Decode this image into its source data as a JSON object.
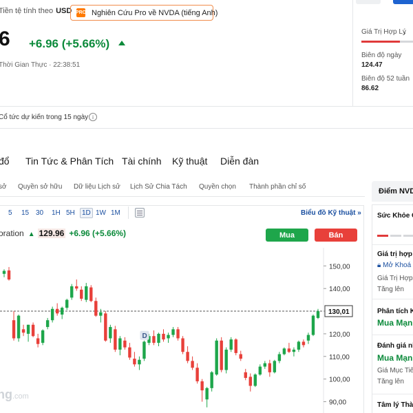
{
  "header": {
    "currency_label": "Tiền tệ tính theo",
    "currency": "USD",
    "pro_button": "Nghiên Cứu Pro về NVDA (tiếng Anh)",
    "pro_icon": "pro-badge-icon",
    "price_partial": "6",
    "change": "+6.96 (+5.66%)",
    "realtime": "Thời Gian Thực · 22:38:51",
    "dividend": "Cổ tức dự kiến trong 15 ngày"
  },
  "right_panel": {
    "fair_value_label": "Giá Trị Hợp Lý",
    "fair_value_fill": 0.7,
    "day_range_label": "Biên độ ngày",
    "day_range_value": "124.47",
    "week52_label": "Biên độ 52 tuần",
    "week52_value": "86.62"
  },
  "nav": {
    "tabs": [
      "đổ",
      "Tin Tức & Phân Tích",
      "Tài chính",
      "Kỹ thuật",
      "Diễn đàn"
    ],
    "subtabs": [
      "sở",
      "Quyền sở hữu",
      "Dữ liệu Lịch sử",
      "Lịch Sử Chia Tách",
      "Quyền chọn",
      "Thành phần chỉ số"
    ]
  },
  "toolbar": {
    "timeframes": [
      "5",
      "15",
      "30",
      "1H",
      "5H",
      "1D",
      "1W",
      "1M"
    ],
    "selected": "1D",
    "tech_chart_link": "Biểu đồ Kỹ thuật",
    "tech_chart_chevron": "»"
  },
  "ticker": {
    "name": "oration",
    "price": "129.96",
    "change": "+6.96 (+5.66%)",
    "buy": "Mua",
    "sell": "Bán"
  },
  "side": {
    "title": "Điểm NVD",
    "health": "Sức Khỏe C",
    "health_fill": 0.33,
    "fair_value": "Giá trị hợp l",
    "fair_value_link": "Mở Khoá",
    "fair_value_sub": "Giá Trị Hợp",
    "fair_value_trend": "Tăng lên",
    "analyst": "Phân tích K",
    "analyst_rating": "Mua Mạnh",
    "rating_label": "Đánh giá nh",
    "rating_value": "Mua Mạnh",
    "target_label": "Giá Mục Tiê",
    "target_trend": "Tăng lên",
    "sentiment": "Tâm lý Thà"
  },
  "watermark": {
    "main": "ng",
    "suffix": ".com"
  },
  "chart_data": {
    "type": "candlestick",
    "y_ticks": [
      "150,00",
      "140,00",
      "130,00",
      "120,00",
      "110,00",
      "100,00",
      "90,00"
    ],
    "ylim": [
      85,
      158
    ],
    "current_price_label": "130,01",
    "current_price": 130.01,
    "dividend_marker": "D",
    "up_color": "#1ea64b",
    "down_color": "#e8403a",
    "candles": [
      {
        "o": 146.5,
        "h": 148.5,
        "l": 145.0,
        "c": 147.8
      },
      {
        "o": 148.0,
        "h": 149.5,
        "l": 143.5,
        "c": 144.0
      },
      {
        "o": 126.0,
        "h": 130.0,
        "l": 117.0,
        "c": 118.0
      },
      {
        "o": 118.0,
        "h": 128.5,
        "l": 116.5,
        "c": 128.0
      },
      {
        "o": 122.0,
        "h": 124.0,
        "l": 119.0,
        "c": 120.5
      },
      {
        "o": 120.0,
        "h": 124.0,
        "l": 116.5,
        "c": 124.0
      },
      {
        "o": 124.0,
        "h": 125.0,
        "l": 118.5,
        "c": 119.0
      },
      {
        "o": 118.0,
        "h": 120.0,
        "l": 114.0,
        "c": 115.5
      },
      {
        "o": 116.0,
        "h": 122.0,
        "l": 115.0,
        "c": 121.5
      },
      {
        "o": 123.0,
        "h": 127.0,
        "l": 122.0,
        "c": 126.0
      },
      {
        "o": 126.0,
        "h": 132.0,
        "l": 125.0,
        "c": 131.0
      },
      {
        "o": 131.0,
        "h": 133.5,
        "l": 128.0,
        "c": 129.0
      },
      {
        "o": 128.5,
        "h": 132.0,
        "l": 126.5,
        "c": 131.5
      },
      {
        "o": 131.5,
        "h": 135.5,
        "l": 130.5,
        "c": 135.0
      },
      {
        "o": 136.0,
        "h": 142.0,
        "l": 135.0,
        "c": 141.0
      },
      {
        "o": 141.0,
        "h": 144.0,
        "l": 139.0,
        "c": 140.0
      },
      {
        "o": 139.5,
        "h": 141.0,
        "l": 134.5,
        "c": 135.5
      },
      {
        "o": 135.0,
        "h": 142.5,
        "l": 134.0,
        "c": 141.0
      },
      {
        "o": 140.5,
        "h": 141.5,
        "l": 134.0,
        "c": 134.5
      },
      {
        "o": 134.5,
        "h": 136.0,
        "l": 127.5,
        "c": 128.0
      },
      {
        "o": 128.0,
        "h": 131.0,
        "l": 125.0,
        "c": 129.5
      },
      {
        "o": 129.0,
        "h": 130.0,
        "l": 116.5,
        "c": 117.0
      },
      {
        "o": 118.0,
        "h": 124.0,
        "l": 116.0,
        "c": 123.0
      },
      {
        "o": 122.0,
        "h": 123.5,
        "l": 112.0,
        "c": 113.0
      },
      {
        "o": 113.0,
        "h": 119.0,
        "l": 110.5,
        "c": 118.0
      },
      {
        "o": 117.0,
        "h": 118.5,
        "l": 113.0,
        "c": 114.0
      },
      {
        "o": 114.0,
        "h": 116.0,
        "l": 108.5,
        "c": 109.5
      },
      {
        "o": 109.0,
        "h": 112.0,
        "l": 105.5,
        "c": 106.5
      },
      {
        "o": 106.5,
        "h": 110.0,
        "l": 104.0,
        "c": 108.5
      },
      {
        "o": 109.0,
        "h": 117.0,
        "l": 108.0,
        "c": 116.5
      },
      {
        "o": 116.0,
        "h": 120.0,
        "l": 115.0,
        "c": 119.0
      },
      {
        "o": 119.0,
        "h": 121.5,
        "l": 115.0,
        "c": 116.0
      },
      {
        "o": 116.0,
        "h": 120.5,
        "l": 114.5,
        "c": 120.0
      },
      {
        "o": 120.0,
        "h": 122.0,
        "l": 116.5,
        "c": 117.5
      },
      {
        "o": 118.0,
        "h": 120.5,
        "l": 116.0,
        "c": 119.5
      },
      {
        "o": 119.5,
        "h": 123.0,
        "l": 118.5,
        "c": 122.0
      },
      {
        "o": 122.0,
        "h": 123.0,
        "l": 117.0,
        "c": 118.0
      },
      {
        "o": 118.0,
        "h": 119.0,
        "l": 111.0,
        "c": 112.0
      },
      {
        "o": 112.0,
        "h": 114.5,
        "l": 107.0,
        "c": 108.0
      },
      {
        "o": 108.0,
        "h": 110.0,
        "l": 104.0,
        "c": 105.0
      },
      {
        "o": 105.0,
        "h": 107.0,
        "l": 98.0,
        "c": 99.0
      },
      {
        "o": 99.0,
        "h": 100.0,
        "l": 90.0,
        "c": 95.0
      },
      {
        "o": 91.0,
        "h": 96.5,
        "l": 87.5,
        "c": 96.0
      },
      {
        "o": 96.0,
        "h": 103.5,
        "l": 94.5,
        "c": 103.0
      },
      {
        "o": 102.0,
        "h": 118.0,
        "l": 101.5,
        "c": 117.0
      },
      {
        "o": 117.0,
        "h": 118.5,
        "l": 103.0,
        "c": 104.0
      },
      {
        "o": 104.0,
        "h": 114.0,
        "l": 102.5,
        "c": 113.0
      },
      {
        "o": 113.0,
        "h": 118.5,
        "l": 112.0,
        "c": 117.5
      },
      {
        "o": 117.5,
        "h": 118.0,
        "l": 110.5,
        "c": 111.5
      },
      {
        "o": 111.0,
        "h": 112.5,
        "l": 108.0,
        "c": 109.0
      },
      {
        "o": 103.0,
        "h": 104.5,
        "l": 99.5,
        "c": 100.5
      },
      {
        "o": 101.0,
        "h": 102.5,
        "l": 94.5,
        "c": 97.0
      },
      {
        "o": 97.0,
        "h": 102.5,
        "l": 96.5,
        "c": 102.0
      },
      {
        "o": 102.0,
        "h": 106.5,
        "l": 101.5,
        "c": 105.5
      },
      {
        "o": 105.5,
        "h": 108.0,
        "l": 104.5,
        "c": 107.0
      },
      {
        "o": 107.0,
        "h": 108.5,
        "l": 101.0,
        "c": 103.0
      },
      {
        "o": 103.0,
        "h": 108.5,
        "l": 102.5,
        "c": 108.0
      },
      {
        "o": 108.0,
        "h": 112.0,
        "l": 107.0,
        "c": 111.0
      },
      {
        "o": 111.0,
        "h": 114.0,
        "l": 110.5,
        "c": 113.5
      },
      {
        "o": 113.5,
        "h": 116.0,
        "l": 111.5,
        "c": 112.0
      },
      {
        "o": 112.0,
        "h": 114.0,
        "l": 110.0,
        "c": 113.0
      },
      {
        "o": 113.0,
        "h": 117.0,
        "l": 112.0,
        "c": 116.5
      },
      {
        "o": 116.5,
        "h": 117.5,
        "l": 114.0,
        "c": 115.0
      },
      {
        "o": 117.0,
        "h": 120.5,
        "l": 115.5,
        "c": 119.5
      },
      {
        "o": 119.5,
        "h": 128.5,
        "l": 119.0,
        "c": 128.0
      },
      {
        "o": 127.0,
        "h": 131.0,
        "l": 126.5,
        "c": 130.0
      }
    ]
  }
}
